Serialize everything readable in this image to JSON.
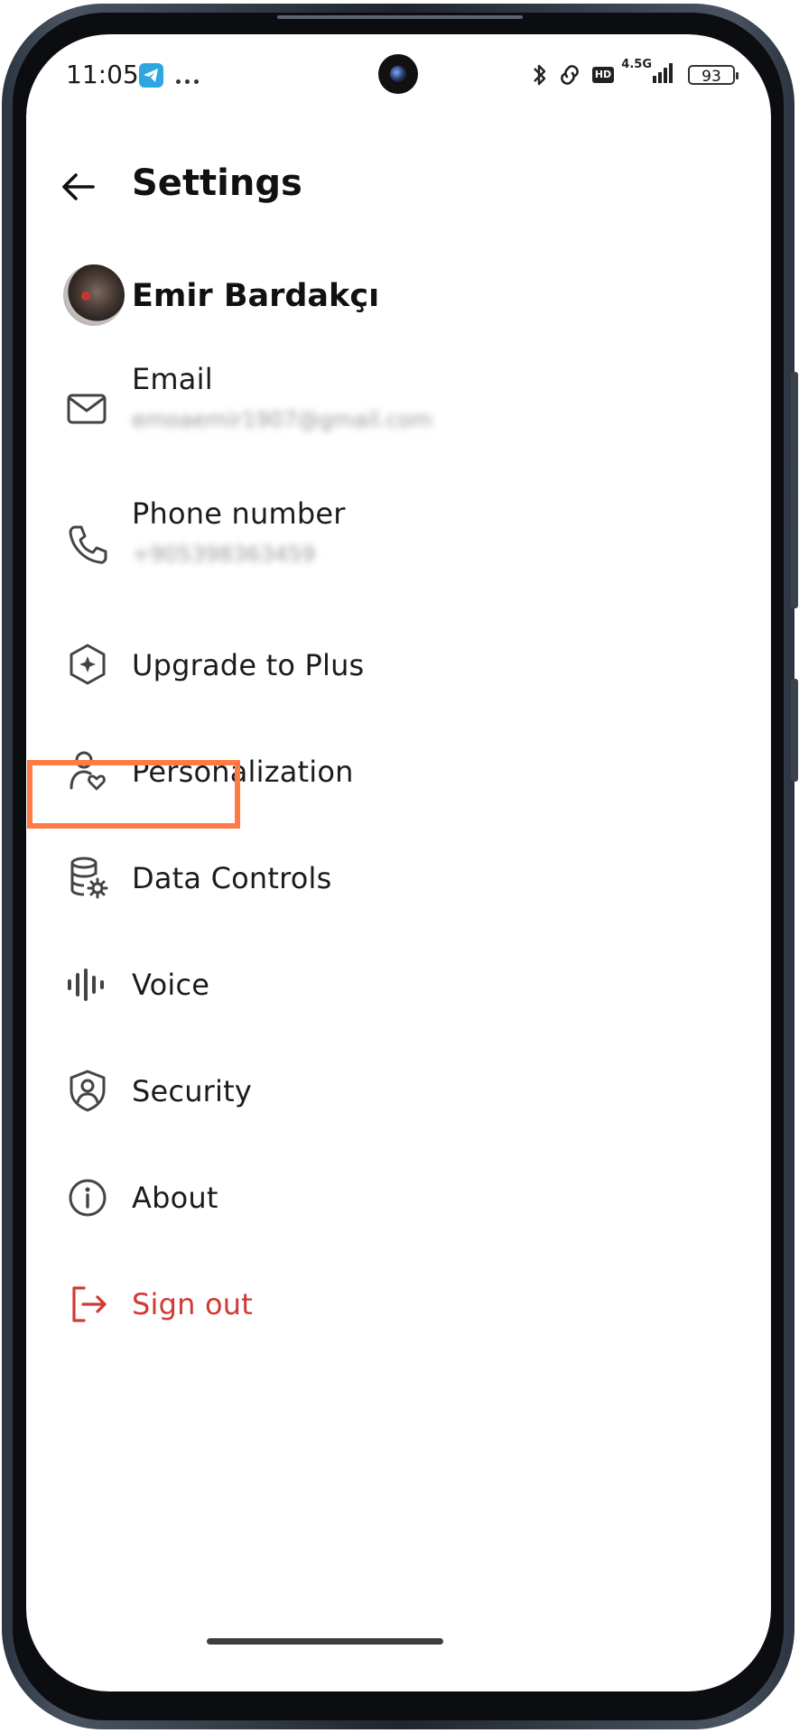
{
  "status_bar": {
    "time": "11:05",
    "network_label": "4.5G",
    "hd_label": "HD",
    "battery_level": "93",
    "icons": [
      "telegram-icon",
      "more-dots-icon",
      "bluetooth-icon",
      "link-icon",
      "hd-icon",
      "signal-icon",
      "battery-icon"
    ]
  },
  "header": {
    "back_icon": "arrow-left-icon",
    "title": "Settings"
  },
  "profile": {
    "name": "Emir Bardakçı"
  },
  "menu": {
    "email": {
      "label": "Email",
      "value": "emoaemir1907@gmail.com",
      "icon": "mail-icon"
    },
    "phone": {
      "label": "Phone number",
      "value": "+905398363459",
      "icon": "phone-icon"
    },
    "upgrade": {
      "label": "Upgrade to Plus",
      "icon": "sparkle-hexagon-icon"
    },
    "personalization": {
      "label": "Personalization",
      "icon": "person-heart-icon"
    },
    "data_controls": {
      "label": "Data Controls",
      "icon": "database-gear-icon"
    },
    "voice": {
      "label": "Voice",
      "icon": "soundwave-icon"
    },
    "security": {
      "label": "Security",
      "icon": "shield-user-icon"
    },
    "about": {
      "label": "About",
      "icon": "info-icon"
    },
    "sign_out": {
      "label": "Sign out",
      "icon": "sign-out-icon"
    }
  },
  "colors": {
    "text": "#1b1b1b",
    "danger": "#d03a35",
    "highlight": "#ff7a45",
    "icon": "#444444"
  }
}
